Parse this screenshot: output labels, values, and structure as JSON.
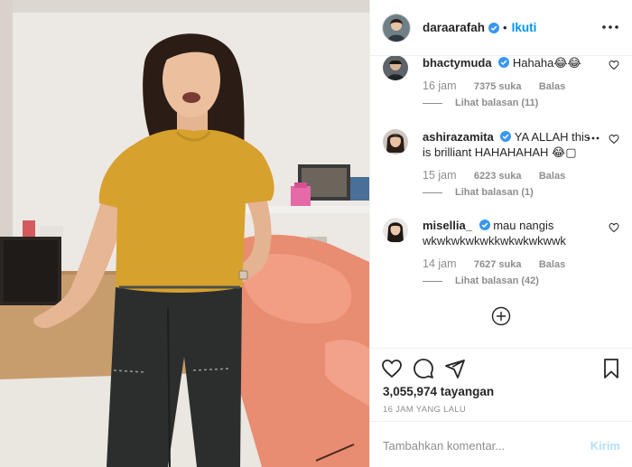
{
  "header": {
    "username": "daraarafah",
    "separator": "•",
    "follow_label": "Ikuti"
  },
  "comments": [
    {
      "username": "bhactymuda",
      "text_lines": [
        "Hahaha😂😂"
      ],
      "time": "16 jam",
      "likes": "7375 suka",
      "reply_label": "Balas",
      "view_replies": "Lihat balasan (11)"
    },
    {
      "username": "ashirazamita",
      "text_lines": [
        "YA ALLAH this",
        "is brilliant HAHAHAHAH 😂▢"
      ],
      "time": "15 jam",
      "likes": "6223 suka",
      "reply_label": "Balas",
      "view_replies": "Lihat balasan (1)"
    },
    {
      "username": "misellia_",
      "text_lines": [
        "mau nangis",
        "wkwkwkwkwkkwkwkwkwwk"
      ],
      "time": "14 jam",
      "likes": "7627 suka",
      "reply_label": "Balas",
      "view_replies": "Lihat balasan (42)"
    }
  ],
  "stats": {
    "views": "3,055,974 tayangan",
    "posted_ago": "16 JAM YANG LALU"
  },
  "composer": {
    "placeholder": "Tambahkan komentar...",
    "send_label": "Kirim"
  },
  "colors": {
    "accent": "#0095f6",
    "verified": "#3897f0",
    "muted_text": "#8e8e8e",
    "send_disabled": "#b2dffc"
  },
  "icons": {
    "header": [
      "verified-badge-icon",
      "more-options-icon"
    ],
    "actions": [
      "heart-icon",
      "comment-icon",
      "share-icon",
      "bookmark-icon"
    ],
    "comments": [
      "heart-icon",
      "more-options-icon"
    ],
    "load": "plus-circle-icon"
  }
}
